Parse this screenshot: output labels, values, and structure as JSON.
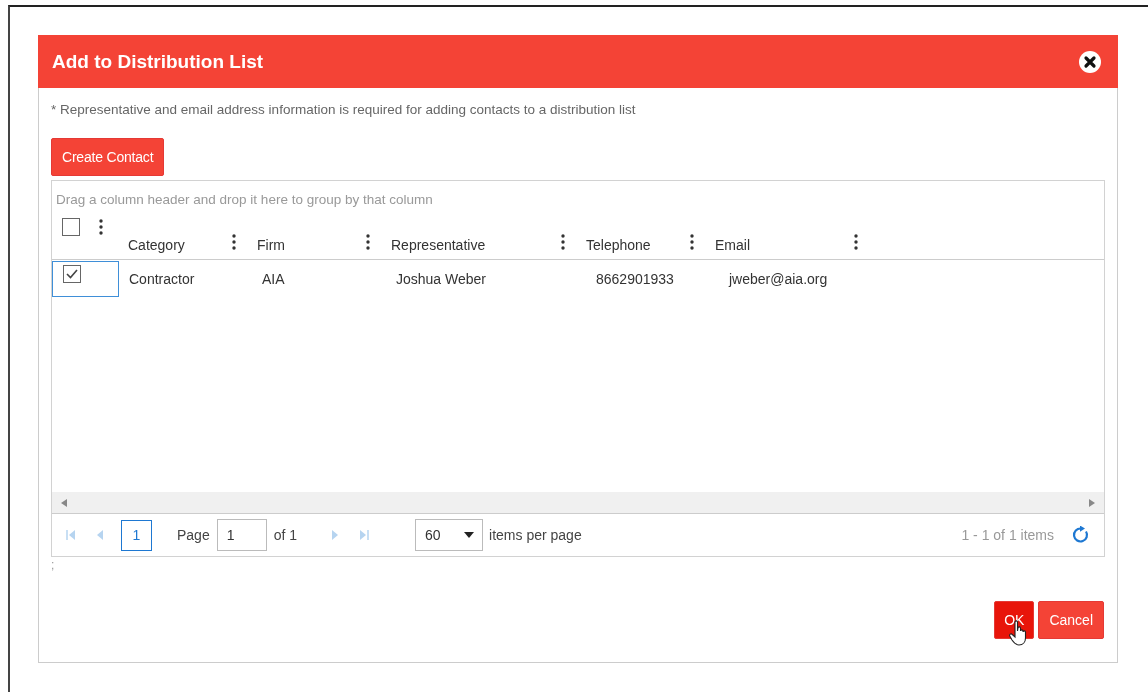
{
  "dialog": {
    "title": "Add to Distribution List",
    "note": "* Representative and email address information is required for adding contacts to a distribution list",
    "create_button": "Create Contact",
    "grid": {
      "group_hint": "Drag a column header and drop it here to group by that column",
      "all_checked": false,
      "columns": [
        "Category",
        "Firm",
        "Representative",
        "Telephone",
        "Email"
      ],
      "rows": [
        {
          "selected": true,
          "cells": [
            "Contractor",
            "AIA",
            "Joshua Weber",
            "8662901933",
            "jweber@aia.org"
          ]
        }
      ]
    },
    "pager": {
      "current": "1",
      "page_label": "Page",
      "page_value": "1",
      "of": "of 1",
      "page_size": "60",
      "per_page": "items per page",
      "summary": "1 - 1 of 1 items"
    },
    "footnote": ";",
    "buttons": [
      {
        "label": "OK",
        "hovered": true
      },
      {
        "label": "Cancel",
        "hovered": false
      }
    ]
  }
}
